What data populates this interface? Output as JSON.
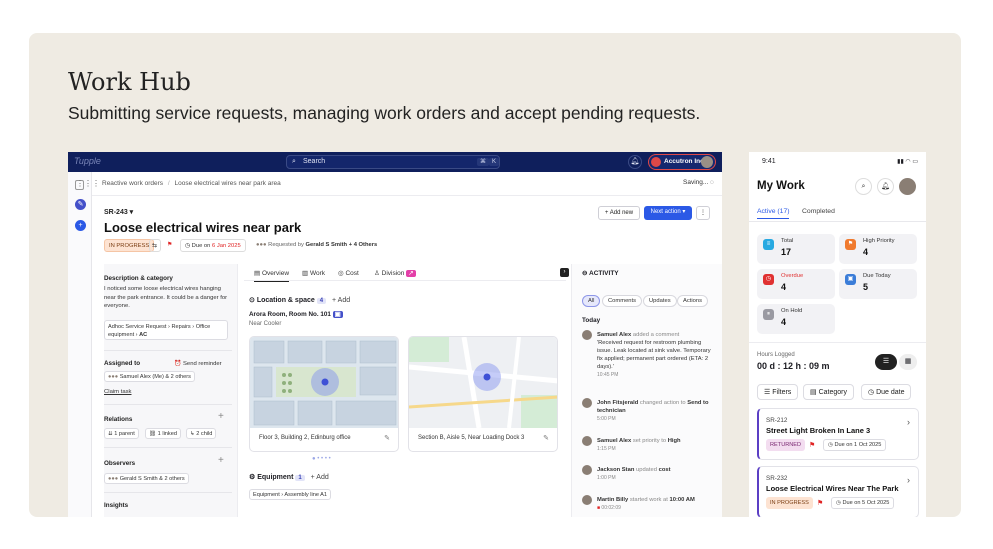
{
  "page": {
    "title": "Work Hub",
    "subtitle": "Submitting service requests, managing work orders and accept pending requests."
  },
  "desktop": {
    "logo": "Tupple",
    "search_placeholder": "Search",
    "search_keys": [
      "⌘",
      "K"
    ],
    "account": "Accutron Inc.",
    "breadcrumb": {
      "root": "Reactive work orders",
      "sep": "/",
      "current": "Loose electrical wires near park area"
    },
    "saving": "Saving...",
    "sr_id": "SR-243",
    "title": "Loose electrical wires near park",
    "add_new": "+ Add new",
    "next_action": "Next action",
    "status": "IN PROGRESS",
    "due_label": "Due on",
    "due_date": "6 Jan 2025",
    "requested_by": "Requested by",
    "requester": "Gerald S Smith + 4 Others",
    "left": {
      "desc_h": "Description & category",
      "desc": "I noticed some loose electrical wires hanging near the park entrance. It could be a danger for everyone.",
      "cat1": "Adhoc Service Request",
      "cat2": "Repairs",
      "cat3": "Office equipment",
      "cat4": "AC",
      "assigned_h": "Assigned to",
      "reminder": "Send reminder",
      "assignees": "Samuel Alex (Me) & 2 others",
      "claim": "Claim task",
      "relations_h": "Relations",
      "rel1": "1 parent",
      "rel2": "1 linked",
      "rel3": "2 child",
      "observers_h": "Observers",
      "observers": "Gerald S Smith & 2 others",
      "insights_h": "Insights"
    },
    "center": {
      "tabs": [
        "Overview",
        "Work",
        "Cost",
        "Division"
      ],
      "location_h": "Location & space",
      "location_count": "4",
      "add": "+ Add",
      "room": "Arora Room, Room No. 101",
      "near": "Near Cooler",
      "map1_cap": "Floor 3, Building 2, Edinburg office",
      "map2_cap": "Section B, Aisle 5, Near Loading Dock 3",
      "equip_h": "Equipment",
      "equip_count": "1",
      "equip_add": "+ Add",
      "equip1": "Equipment",
      "equip2": "Assembly line A1"
    },
    "activity": {
      "title": "ACTIVITY",
      "filters": [
        "All",
        "Comments",
        "Updates",
        "Actions"
      ],
      "today": "Today",
      "items": [
        {
          "who": "Samuel Alex",
          "what": "added a comment",
          "body": "'Received request for restroom plumbing issue. Leak located at sink valve. Temporary fix applied; permanent part ordered (ETA: 2 days).'",
          "time": "10:45 PM"
        },
        {
          "who": "John Fitsjerald",
          "what": "changed action to",
          "target": "Send to technician",
          "time": "5:00 PM"
        },
        {
          "who": "Samuel Alex",
          "what": "set priority to",
          "target": "High",
          "time": "1:15 PM"
        },
        {
          "who": "Jackson Stan",
          "what": "updated",
          "target": "cost",
          "time": "1:00 PM"
        },
        {
          "who": "Martin Billy",
          "what": "started work at",
          "target": "10:00 AM",
          "time": "00:02:09"
        }
      ]
    }
  },
  "phone": {
    "time": "9:41",
    "title": "My Work",
    "tab_active": "Active (17)",
    "tab_other": "Completed",
    "stats": [
      {
        "label": "Total",
        "value": "17",
        "color": "#27a9e1"
      },
      {
        "label": "High Priority",
        "value": "4",
        "color": "#f07a2e"
      },
      {
        "label": "Overdue",
        "value": "4",
        "color": "#e03131"
      },
      {
        "label": "Due Today",
        "value": "5",
        "color": "#3b7dd8"
      },
      {
        "label": "On Hold",
        "value": "4",
        "color": "#9a9aa2"
      }
    ],
    "hours_label": "Hours Logged",
    "hours_value": "00 d : 12 h : 09 m",
    "filters": "Filters",
    "category": "Category",
    "due_date": "Due date",
    "orders": [
      {
        "id": "SR-212",
        "name": "Street Light Broken In Lane 3",
        "status": "RETURNED",
        "due": "Due on 1 Oct 2025"
      },
      {
        "id": "SR-232",
        "name": "Loose Electrical Wires Near The Park",
        "status": "IN PROGRESS",
        "due": "Due on 5 Oct 2025"
      }
    ]
  }
}
